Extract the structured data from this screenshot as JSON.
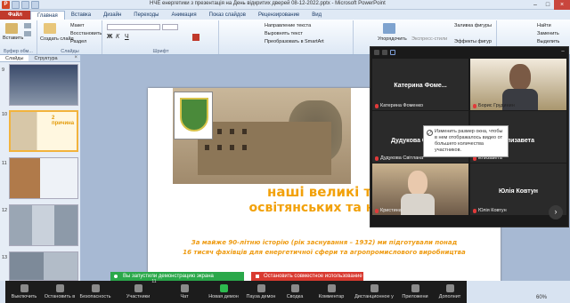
{
  "window": {
    "title": "НЧЕ енергетики з презентація на День відкритих дверей 08-12-2022.pptx - Microsoft PowerPoint"
  },
  "ribbon_tabs": [
    "Файл",
    "Главная",
    "Вставка",
    "Дизайн",
    "Переходы",
    "Анимация",
    "Показ слайдов",
    "Рецензирование",
    "Вид"
  ],
  "ribbon": {
    "paste_label": "Вставить",
    "clipboard_group": "Буфер обм...",
    "new_slide_label": "Создать слайд",
    "layout": "Макет",
    "reset": "Восстановить",
    "section": "Раздел",
    "slides_group": "Слайды",
    "font_group": "Шрифт",
    "text_direction": "Направление текста",
    "align_text": "Выровнять текст",
    "smartart": "Преобразовать в SmartArt",
    "arrange": "Упорядочить",
    "quick_styles": "Экспресс-стили",
    "shape_fill": "Заливка фигуры",
    "shape_effects": "Эффекты фигур",
    "find": "Найти",
    "replace": "Заменить",
    "select": "Выделить"
  },
  "left_pane": {
    "tab_slides": "Слайды",
    "tab_outline": "Структура",
    "close": "×",
    "slides": [
      {
        "num": "9"
      },
      {
        "num": "10",
        "text": "2 причина"
      },
      {
        "num": "11"
      },
      {
        "num": "12"
      },
      {
        "num": "13"
      }
    ]
  },
  "slide": {
    "headline_line1": "наші великі тр",
    "headline_line2": "освітянських та наук",
    "side_word": "П",
    "subline_1": "За майже 90-літню історію (рік заснування – 1932) ми підготували понад",
    "subline_2": "16 тисяч фахівців для енергетичної сфери та агропромислового виробництва"
  },
  "zoom_panel": {
    "tiles": [
      {
        "big": "Катерина Фоме...",
        "tag": "Катерина Фоменко"
      },
      {
        "big": "",
        "tag": "Борис Грудинин"
      },
      {
        "big": "Дудукова Світлана",
        "tag": "Дудукова Світлана"
      },
      {
        "big": "Елизавета",
        "tag": "Елизавета"
      },
      {
        "big": "",
        "tag": "Кристина"
      },
      {
        "big": "Юлія Ковтун",
        "tag": "Юлія Ковтун"
      }
    ],
    "tooltip": "Изменить размер окна, чтобы в нем отображалось видео от большего количества участников.",
    "next_icon": "›",
    "minimize": "−"
  },
  "zoom_toolbar": {
    "items": [
      "Выключить",
      "Остановить в",
      "Безопасность",
      "Участники",
      "Чат",
      "Новая демон",
      "Пауза демон",
      "Сводка",
      "Комментар",
      "Дистанционное у",
      "Приложени",
      "Дополнит"
    ],
    "participants_count": "11",
    "share_banner": "Вы запустили демонстрацию экрана",
    "stop_banner": "Остановить совместное использование"
  },
  "status": {
    "zoom_level": "60%"
  },
  "colors": {
    "accent_orange": "#f2a10a",
    "file_tab": "#c0392b",
    "share_green": "#2aa84a",
    "stop_red": "#d93a30"
  }
}
